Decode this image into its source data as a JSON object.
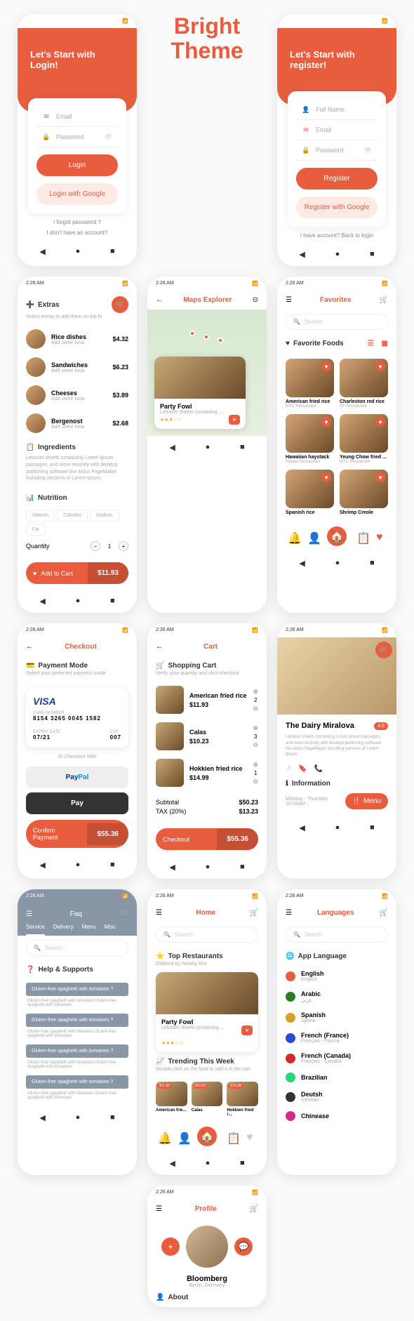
{
  "theme": {
    "l1": "Bright",
    "l2": "Theme"
  },
  "status_time": "2:26 AM",
  "login": {
    "title": "Let's Start with Login!",
    "email": "Email",
    "password": "Password",
    "btn": "Login",
    "btn2": "Login with Google",
    "link1": "I forgot password ?",
    "link2": "I don't have an account?"
  },
  "register": {
    "title": "Let's Start with register!",
    "name": "Full Name",
    "email": "Email",
    "password": "Password",
    "btn": "Register",
    "btn2": "Register with Google",
    "link": "I have account? Back to login"
  },
  "extras": {
    "title": "Extras",
    "sub": "Select extras to add them on the fo",
    "items": [
      {
        "n": "Rice dishes",
        "s": "Add some tuna",
        "p": "$4.32"
      },
      {
        "n": "Sandwiches",
        "s": "Add some tuna",
        "p": "$6.23"
      },
      {
        "n": "Cheeses",
        "s": "Add some tuna",
        "p": "$3.89"
      },
      {
        "n": "Bergenost",
        "s": "Add some tuna",
        "p": "$2.68"
      }
    ],
    "ing": "Ingredients",
    "desc": "Letraset sheets containing Lorem Ipsum passages, and more recently with desktop publishing software like Aldus PageMaker including versions of Lorem Ipsum.",
    "nut": "Nutrition",
    "chips": [
      "Vitamin",
      "Calories",
      "Sodium",
      "Fat"
    ],
    "qty": "Quantity",
    "qn": "1",
    "add": "Add to Cart",
    "price": "$11.93"
  },
  "checkout": {
    "title": "Checkout",
    "pm": "Payment Mode",
    "pms": "Select your preferred payment mode",
    "card_lbl": "CARD NUMBER",
    "card": "8154 3265 0045 1582",
    "exp_lbl": "EXPIRY DATE",
    "exp": "07/21",
    "cvv_lbl": "CVV",
    "cvv": "007",
    "or": "Or Checkout With",
    "pp": "PayPal",
    "ap": "Pay",
    "confirm": "Confirm Payment",
    "total": "$55.36"
  },
  "faq": {
    "title": "Faq",
    "tabs": [
      "Service",
      "Delivery",
      "Menu",
      "Misc"
    ],
    "search": "Search",
    "help": "Help & Supports",
    "q": "Gluten-free spaghetti with tomatoes ?",
    "a": "Gluten-free spaghetti with tomatoes Gluten-free spaghetti with tomatoes"
  },
  "maps": {
    "title": "Maps Explorer",
    "name": "Party Fowl",
    "sub": "Letraset sheets containing ..."
  },
  "cart": {
    "title": "Cart",
    "sh": "Shopping Cart",
    "ss": "Verify your quantity and click checkout",
    "items": [
      {
        "n": "American fried rice",
        "p": "$11.93",
        "q": "2"
      },
      {
        "n": "Calas",
        "p": "$10.23",
        "q": "3"
      },
      {
        "n": "Hokkien fried rice",
        "p": "$14.99",
        "q": "1"
      }
    ],
    "sub": "Subtotal",
    "subv": "$50.23",
    "tax": "TAX (20%)",
    "taxv": "$13.23",
    "co": "Checkout",
    "total": "$55.36"
  },
  "home": {
    "title": "Home",
    "search": "Search",
    "top": "Top Restaurants",
    "tops": "Ordered by Nearby first",
    "name": "Party Fowl",
    "sub": "Letraset sheets containing ...",
    "trend": "Trending This Week",
    "trends": "Double click on the food to add it to the cart",
    "t": [
      {
        "n": "American frie...",
        "p": "$11.93"
      },
      {
        "n": "Calas",
        "p": "$10.23"
      },
      {
        "n": "Hokkien fried r...",
        "p": "$14.99"
      }
    ]
  },
  "profile": {
    "title": "Profile",
    "name": "Bloomberg",
    "loc": "Berlin, Germany",
    "about": "About"
  },
  "fav": {
    "title": "Favorites",
    "search": "Search",
    "ff": "Favorite Foods",
    "items": [
      {
        "n": "American fried rice",
        "r": "NYC Restaurant"
      },
      {
        "n": "Charleston red rice",
        "r": "SF Restaurant"
      },
      {
        "n": "Hawaiian haystack",
        "r": "Hawaii Restaurant"
      },
      {
        "n": "Yeung Chow fried ...",
        "r": "NYC Restaurant"
      },
      {
        "n": "Spanish rice",
        "r": ""
      },
      {
        "n": "Shrimp Creole",
        "r": ""
      }
    ]
  },
  "rest": {
    "name": "The Dairy Miralova",
    "rating": "4.9",
    "desc": "Letraset sheets containing Lorem Ipsum passages, and more recently with desktop publishing software like Aldus PageMaker including versions of Lorem Ipsum.",
    "info": "Information",
    "hours": "Monday - Thursday   10:00AM -",
    "menu": "Menu"
  },
  "lang": {
    "title": "Languages",
    "search": "Search",
    "app": "App Language",
    "items": [
      {
        "n": "English",
        "s": "English"
      },
      {
        "n": "Arabic",
        "s": "عربي"
      },
      {
        "n": "Spanish",
        "s": "Spana"
      },
      {
        "n": "French (France)",
        "s": "Français - France"
      },
      {
        "n": "French (Canada)",
        "s": "Français - Canada"
      },
      {
        "n": "Brazilian",
        "s": ""
      },
      {
        "n": "Deutsh",
        "s": "German"
      },
      {
        "n": "Chinease",
        "s": ""
      }
    ]
  }
}
